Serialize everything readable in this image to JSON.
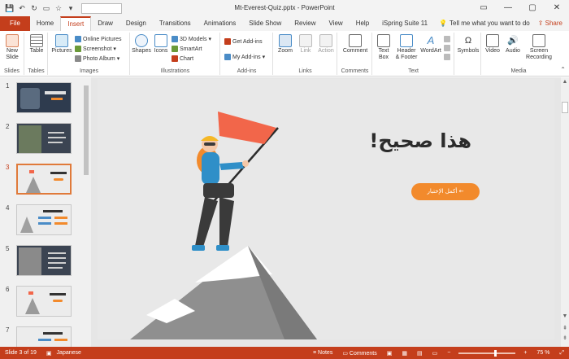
{
  "window": {
    "title": "Mt-Everest-Quiz.pptx  -  PowerPoint",
    "controls": {
      "minimize": "—",
      "restore": "▢",
      "close": "✕"
    },
    "ribbon_display": "▭"
  },
  "tabs": [
    "File",
    "Home",
    "Insert",
    "Draw",
    "Design",
    "Transitions",
    "Animations",
    "Slide Show",
    "Review",
    "View",
    "Help",
    "iSpring Suite 11"
  ],
  "active_tab": "Insert",
  "tell_me": "Tell me what you want to do",
  "share": "Share",
  "ribbon": {
    "slides": {
      "new_slide": "New\nSlide",
      "label": "Slides"
    },
    "tables": {
      "table": "Table",
      "label": "Tables"
    },
    "images": {
      "pictures": "Pictures",
      "online_pictures": "Online Pictures",
      "screenshot": "Screenshot",
      "photo_album": "Photo Album",
      "label": "Images"
    },
    "illustrations": {
      "shapes": "Shapes",
      "icons": "Icons",
      "models_3d": "3D Models",
      "smartart": "SmartArt",
      "chart": "Chart",
      "label": "Illustrations"
    },
    "addins": {
      "get_addins": "Get Add-ins",
      "my_addins": "My Add-ins",
      "label": "Add-ins"
    },
    "links": {
      "zoom": "Zoom",
      "link": "Link",
      "action": "Action",
      "label": "Links"
    },
    "comments": {
      "comment": "Comment",
      "label": "Comments"
    },
    "text": {
      "text_box": "Text\nBox",
      "header_footer": "Header\n& Footer",
      "wordart": "WordArt",
      "label": "Text"
    },
    "symbols": {
      "symbols": "Symbols",
      "label": ""
    },
    "media": {
      "video": "Video",
      "audio": "Audio",
      "screen_recording": "Screen\nRecording",
      "label": "Media"
    }
  },
  "thumbnails": [
    {
      "num": "1",
      "selected": false
    },
    {
      "num": "2",
      "selected": false
    },
    {
      "num": "3",
      "selected": true
    },
    {
      "num": "4",
      "selected": false
    },
    {
      "num": "5",
      "selected": false
    },
    {
      "num": "6",
      "selected": false
    },
    {
      "num": "7",
      "selected": false
    }
  ],
  "slide": {
    "headline": "هذا صحيح!",
    "cta_label": "أكمل الإختبار ←",
    "colors": {
      "flag": "#f2664a",
      "button": "#f28a2c",
      "background": "#e8e8e8"
    }
  },
  "status": {
    "slide_info": "Slide 3 of 19",
    "language": "Japanese",
    "notes": "Notes",
    "comments": "Comments",
    "zoom": "75 %"
  },
  "colors": {
    "accent": "#c43e1c"
  }
}
